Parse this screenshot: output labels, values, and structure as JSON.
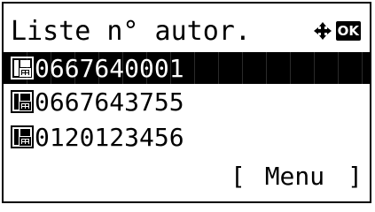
{
  "screen": {
    "title": "Liste n° autor.",
    "ok_label": "OK",
    "nav_icon": "four-way-arrow-icon",
    "list_item_icon": "fax-address-icon",
    "items": [
      {
        "number": "0667640001",
        "selected": true
      },
      {
        "number": "0667643755",
        "selected": false
      },
      {
        "number": "0120123456",
        "selected": false
      }
    ],
    "softkey": {
      "open_bracket": "[",
      "label": "Menu",
      "close_bracket": "]"
    }
  }
}
